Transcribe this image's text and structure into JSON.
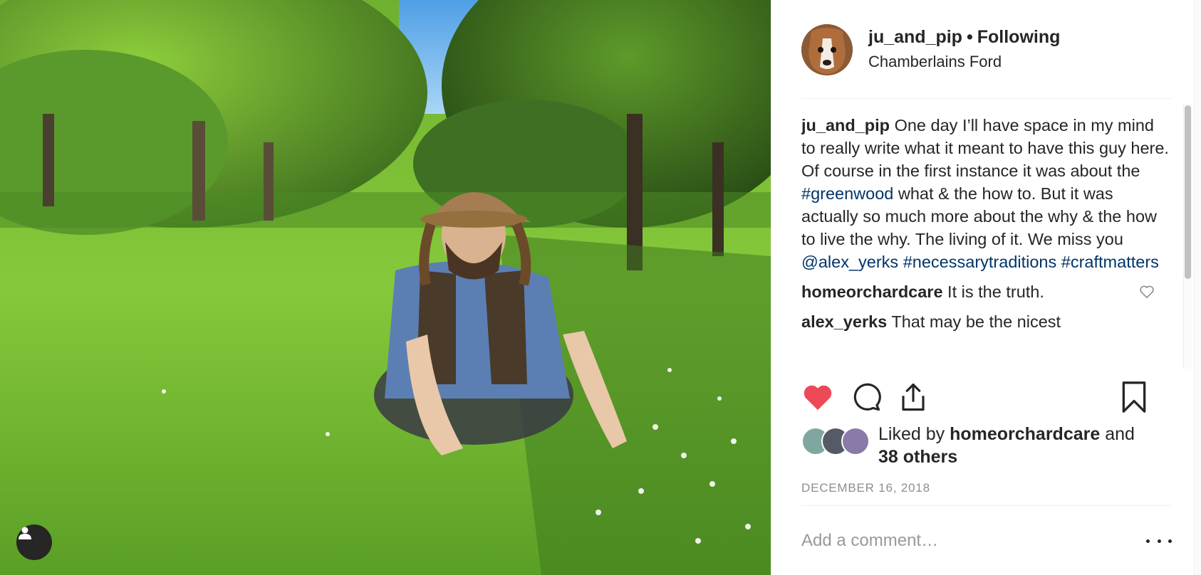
{
  "post": {
    "username": "ju_and_pip",
    "follow_status": "Following",
    "separator": "•",
    "location": "Chamberlains Ford"
  },
  "caption": {
    "username": "ju_and_pip",
    "text_1": " One day I’ll have space in my mind to really write what it meant to have this guy here. Of course in the first instance it was about the ",
    "tag_greenwood": "#greenwood",
    "text_2": " what & the how to. But it was actually so much more about the why & the how to live the why. The living of it. We miss you ",
    "mention": "@alex_yerks",
    "tag_traditions": "#necessarytraditions",
    "tag_craft": "#craftmatters"
  },
  "comments": [
    {
      "username": "homeorchardcare",
      "text": " It is the truth."
    },
    {
      "username": "alex_yerks",
      "text": " That may be the nicest"
    }
  ],
  "likes": {
    "prefix": "Liked by ",
    "user": "homeorchardcare",
    "and": " and",
    "others": "38 others"
  },
  "date": "DECEMBER 16, 2018",
  "comment_box": {
    "placeholder": "Add a comment…"
  },
  "colors": {
    "like": "#ed4956",
    "hashtag": "#003569",
    "muted": "#8e8e8e"
  },
  "icons": [
    "heart-filled-icon",
    "comment-icon",
    "share-icon",
    "bookmark-icon",
    "heart-outline-icon",
    "person-icon",
    "more-icon"
  ]
}
